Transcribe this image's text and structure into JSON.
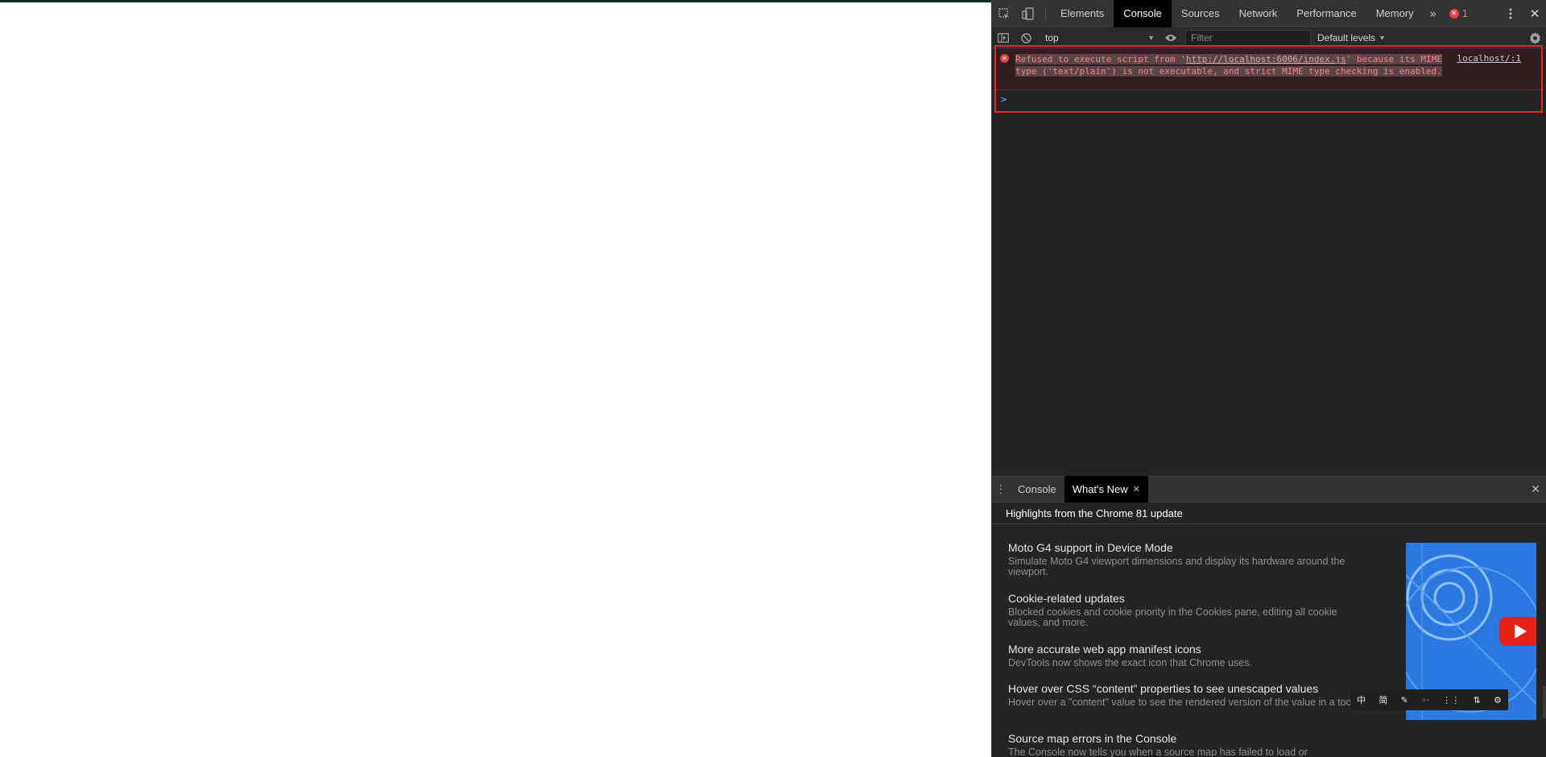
{
  "devtools": {
    "tabs": [
      "Elements",
      "Console",
      "Sources",
      "Network",
      "Performance",
      "Memory"
    ],
    "active_tab": "Console",
    "more_tabs_icon": "chevrons-right-icon",
    "error_count": "1",
    "toolbar": {
      "context": "top",
      "filter_placeholder": "Filter",
      "levels": "Default levels"
    },
    "console": {
      "error": {
        "prefix": "Refused to execute script from '",
        "url": "http://localhost:6006/index.js",
        "suffix": "' because its MIME type ('text/plain') is not executable, and strict MIME type checking is enabled.",
        "source": "localhost/:1"
      },
      "prompt": ">"
    },
    "drawer": {
      "tabs": [
        "Console",
        "What's New"
      ],
      "active_tab": "What's New",
      "header": "Highlights from the Chrome 81 update",
      "items": [
        {
          "title": "Moto G4 support in Device Mode",
          "desc": "Simulate Moto G4 viewport dimensions and display its hardware around the viewport."
        },
        {
          "title": "Cookie-related updates",
          "desc": "Blocked cookies and cookie priority in the Cookies pane, editing all cookie values, and more."
        },
        {
          "title": "More accurate web app manifest icons",
          "desc": "DevTools now shows the exact icon that Chrome uses."
        },
        {
          "title": "Hover over CSS “content” properties to see unescaped values",
          "desc": "Hover over a \"content\" value to see the rendered version of the value in a tooltip."
        },
        {
          "title": "Source map errors in the Console",
          "desc": "The Console now tells you when a source map has failed to load or"
        }
      ],
      "ime_toolbar": [
        "中",
        "简",
        "✎",
        "◦‧",
        "⋮⋮",
        "⇅",
        "⚙"
      ]
    }
  }
}
